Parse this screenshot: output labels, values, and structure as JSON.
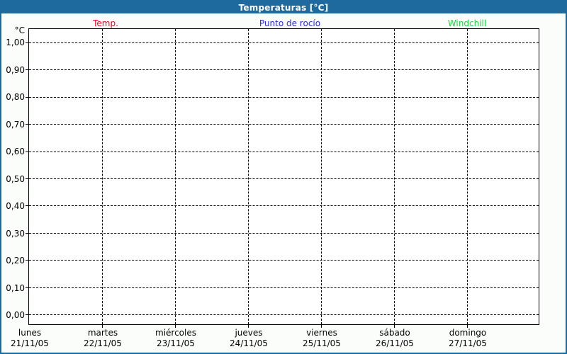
{
  "header": {
    "title": "Temperaturas [°C]",
    "background": "#1e6a9e",
    "text_color": "#ffffff"
  },
  "legend": {
    "items": [
      {
        "label": "Temp.",
        "color": "#ff0022"
      },
      {
        "label": "Punto de rocío",
        "color": "#2a2ad4"
      },
      {
        "label": "Windchill",
        "color": "#22d244"
      }
    ]
  },
  "axes": {
    "y": {
      "unit": "°C",
      "ticks": [
        "1,00",
        "0,90",
        "0,80",
        "0,70",
        "0,60",
        "0,50",
        "0,40",
        "0,30",
        "0,20",
        "0,10",
        "0,00"
      ]
    },
    "x": {
      "days": [
        {
          "name": "lunes",
          "date": "21/11/05"
        },
        {
          "name": "martes",
          "date": "22/11/05"
        },
        {
          "name": "miércoles",
          "date": "23/11/05"
        },
        {
          "name": "jueves",
          "date": "24/11/05"
        },
        {
          "name": "viernes",
          "date": "25/11/05"
        },
        {
          "name": "sábado",
          "date": "26/11/05"
        },
        {
          "name": "domingo",
          "date": "27/11/05"
        }
      ]
    }
  },
  "chart_data": {
    "type": "line",
    "title": "Temperaturas [°C]",
    "ylabel": "°C",
    "ylim": [
      0.0,
      1.0
    ],
    "ytick_step": 0.1,
    "x_categories": [
      "lunes 21/11/05",
      "martes 22/11/05",
      "miércoles 23/11/05",
      "jueves 24/11/05",
      "viernes 25/11/05",
      "sábado 26/11/05",
      "domingo 27/11/05"
    ],
    "series": [
      {
        "name": "Temp.",
        "color": "#ff0022",
        "values": []
      },
      {
        "name": "Punto de rocío",
        "color": "#2a2ad4",
        "values": []
      },
      {
        "name": "Windchill",
        "color": "#22d244",
        "values": []
      }
    ],
    "grid": "dashed",
    "legend_position": "top"
  },
  "colors": {
    "page_background": "#fbfdfb",
    "page_border": "#1e6a9e",
    "plot_background": "#ffffff",
    "grid": "#000000"
  }
}
